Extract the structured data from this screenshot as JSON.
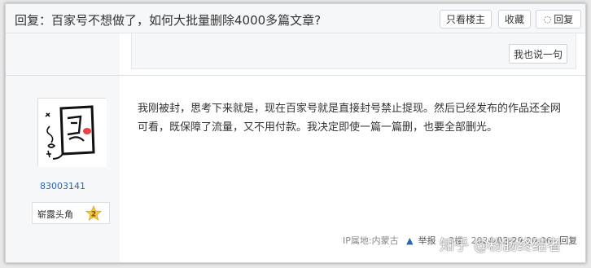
{
  "header": {
    "title": "回复：百家号不想做了，如何大批量删除4000多篇文章?",
    "buttons": {
      "only_op": "只看楼主",
      "favorite": "收藏",
      "reply": "回复"
    }
  },
  "previous_post": {
    "say_button": "我也说一句"
  },
  "author": {
    "username": "83003141",
    "rank_label": "崭露头角",
    "rank_level": "2"
  },
  "post": {
    "text": "我刚被封，思考下来就是，现在百家号就是直接封号禁止提现。然后已经发布的作品还全网可看，既保障了流量，又不用付款。我决定即使一篇一篇删，也要全部删光。",
    "meta": {
      "ip_location": "IP属地:内蒙古",
      "report": "举报",
      "floor": "3楼",
      "timestamp": "2024-02-29 20:06",
      "reply": "回复"
    }
  },
  "watermark": "知乎 @粉肠终结者",
  "colors": {
    "link_blue": "#2d64b3",
    "header_bg": "#f6f7f9",
    "badge_gold": "#f5c73a"
  }
}
